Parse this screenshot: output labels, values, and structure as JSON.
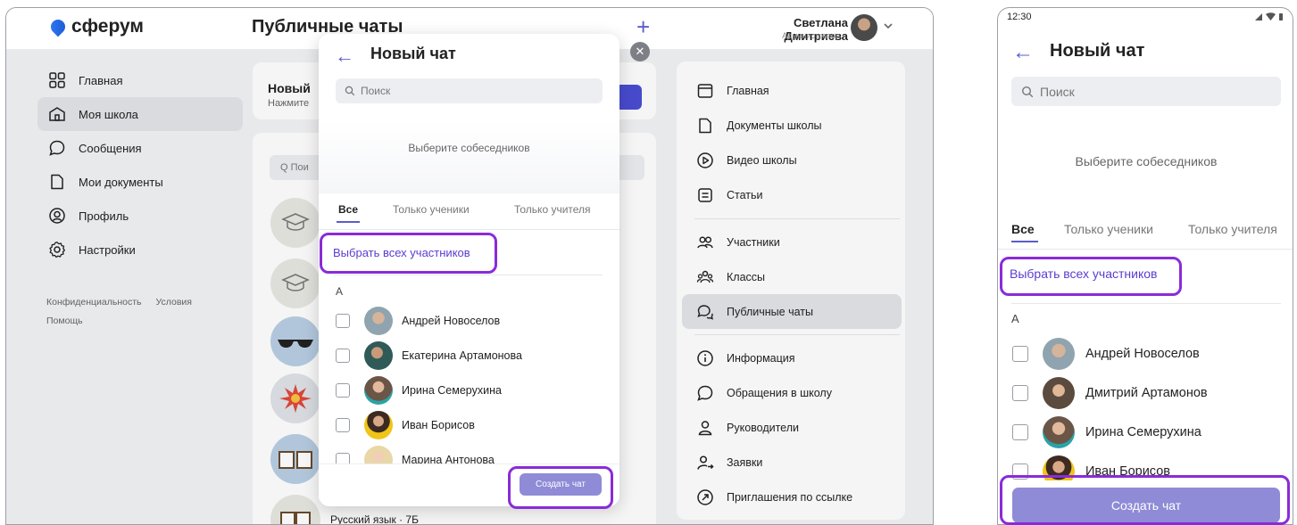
{
  "desktop": {
    "logo_text": "сферум",
    "page_title": "Публичные чаты",
    "user": {
      "name": "Светлана Дмитриева",
      "role": "Администратор"
    },
    "sidebar": {
      "items": [
        {
          "label": "Главная",
          "icon": "grid-icon"
        },
        {
          "label": "Моя школа",
          "icon": "school-icon"
        },
        {
          "label": "Сообщения",
          "icon": "message-icon"
        },
        {
          "label": "Мои документы",
          "icon": "document-icon"
        },
        {
          "label": "Профиль",
          "icon": "profile-icon"
        },
        {
          "label": "Настройки",
          "icon": "gear-icon"
        }
      ],
      "footer": {
        "privacy": "Конфиденциальность",
        "terms": "Условия",
        "help": "Помощь"
      }
    },
    "background": {
      "card_title": "Новый",
      "card_subtitle": "Нажмите",
      "search_placeholder": "Q Пои",
      "chat_label": "Русский язык · 7Б"
    },
    "right_nav": {
      "items": [
        {
          "label": "Главная",
          "icon": "browser-icon"
        },
        {
          "label": "Документы школы",
          "icon": "document-icon"
        },
        {
          "label": "Видео школы",
          "icon": "play-icon"
        },
        {
          "label": "Статьи",
          "icon": "article-icon"
        },
        {
          "label": "Участники",
          "icon": "people-icon"
        },
        {
          "label": "Классы",
          "icon": "group-icon"
        },
        {
          "label": "Публичные чаты",
          "icon": "chats-icon"
        },
        {
          "label": "Информация",
          "icon": "info-icon"
        },
        {
          "label": "Обращения в школу",
          "icon": "message-icon"
        },
        {
          "label": "Руководители",
          "icon": "person-icon"
        },
        {
          "label": "Заявки",
          "icon": "person-add-icon"
        },
        {
          "label": "Приглашения по ссылке",
          "icon": "link-arrow-icon"
        }
      ]
    },
    "modal": {
      "title": "Новый чат",
      "search_placeholder": "Поиск",
      "empty_text": "Выберите собеседников",
      "tabs": [
        "Все",
        "Только ученики",
        "Только учителя"
      ],
      "select_all": "Выбрать всех участников",
      "letter": "А",
      "people": [
        "Андрей Новоселов",
        "Екатерина Артамонова",
        "Ирина Семерухина",
        "Иван Борисов",
        "Марина Антонова"
      ],
      "create_button": "Создать чат"
    }
  },
  "mobile": {
    "time": "12:30",
    "title": "Новый чат",
    "search_placeholder": "Поиск",
    "empty_text": "Выберите собеседников",
    "tabs": [
      "Все",
      "Только ученики",
      "Только учителя"
    ],
    "select_all": "Выбрать всех участников",
    "letter": "А",
    "people": [
      "Андрей Новоселов",
      "Дмитрий Артамонов",
      "Ирина Семерухина",
      "Иван Борисов"
    ],
    "create_button": "Создать чат"
  },
  "colors": {
    "accent": "#5a5dcc",
    "highlight": "#8a2bd8",
    "button": "#8f8bd6"
  }
}
